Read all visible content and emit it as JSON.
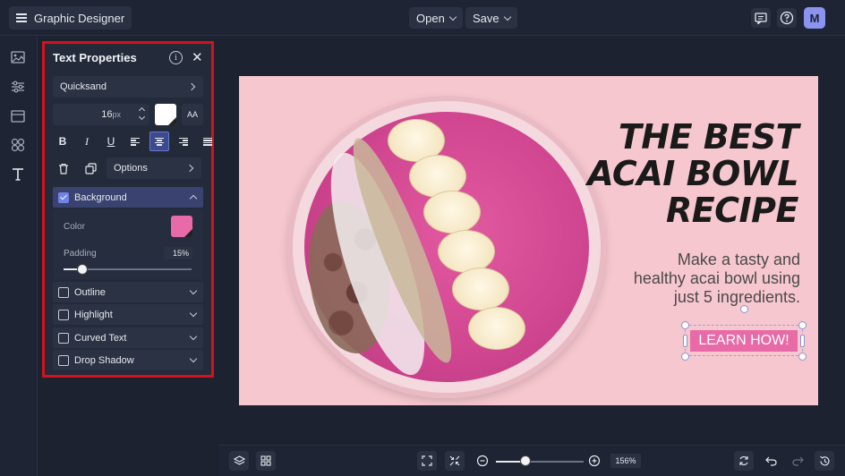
{
  "app": {
    "title": "Graphic Designer"
  },
  "topbar": {
    "open_label": "Open",
    "save_label": "Save",
    "avatar_initial": "M"
  },
  "panel": {
    "title": "Text Properties",
    "font_family": "Quicksand",
    "font_size": "16",
    "font_size_unit": "px",
    "text_color": "#ffffff",
    "case_label": "AA",
    "format_buttons": {
      "bold": "B",
      "italic": "I",
      "underline": "U"
    },
    "active_alignment": "center",
    "options_label": "Options",
    "sections": {
      "background": {
        "label": "Background",
        "checked": true,
        "expanded": true
      },
      "outline": {
        "label": "Outline",
        "checked": false
      },
      "highlight": {
        "label": "Highlight",
        "checked": false
      },
      "curved_text": {
        "label": "Curved Text",
        "checked": false
      },
      "drop_shadow": {
        "label": "Drop Shadow",
        "checked": false
      }
    },
    "background": {
      "color_label": "Color",
      "color": "#e86aa6",
      "padding_label": "Padding",
      "padding_value": "15%",
      "padding_fraction": 0.15
    }
  },
  "design": {
    "headline": [
      "THE BEST",
      "ACAI BOWL",
      "RECIPE"
    ],
    "subline": [
      "Make a tasty and",
      "healthy acai bowl using",
      "just 5 ingredients."
    ],
    "cta_label": "LEARN HOW!",
    "background_color": "#f7c7cf",
    "cta_color": "#e86aa6"
  },
  "bottombar": {
    "zoom_value": "156%",
    "zoom_fraction": 0.34
  },
  "colors": {
    "accent": "#6f83e8",
    "highlight_border": "#d3121c"
  }
}
